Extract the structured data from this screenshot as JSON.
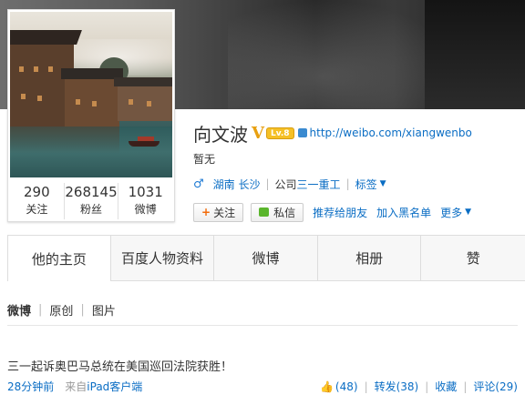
{
  "profile": {
    "name": "向文波",
    "v_badge": "V",
    "level_badge": "Lv.8",
    "url": "http://weibo.com/xiangwenbo",
    "bio": "暂无",
    "location": "湖南 长沙",
    "company_prefix": "公司",
    "company": "三一重工",
    "tags_label": "标签",
    "stats": [
      {
        "num": "290",
        "label": "关注"
      },
      {
        "num": "268145",
        "label": "粉丝"
      },
      {
        "num": "1031",
        "label": "微博"
      }
    ]
  },
  "actions": {
    "follow": "关注",
    "message": "私信",
    "recommend": "推荐给朋友",
    "blacklist": "加入黑名单",
    "more": "更多"
  },
  "tabs": [
    "他的主页",
    "百度人物资料",
    "微博",
    "相册",
    "赞"
  ],
  "filter": [
    "微博",
    "原创",
    "图片"
  ],
  "post": {
    "text": "三一起诉奥巴马总统在美国巡回法院获胜！",
    "time": "28分钟前",
    "from_prefix": "来自",
    "from_client": "iPad客户端",
    "likes": "(48)",
    "repost": "转发(38)",
    "favorite": "收藏",
    "comment": "评论(29)"
  }
}
